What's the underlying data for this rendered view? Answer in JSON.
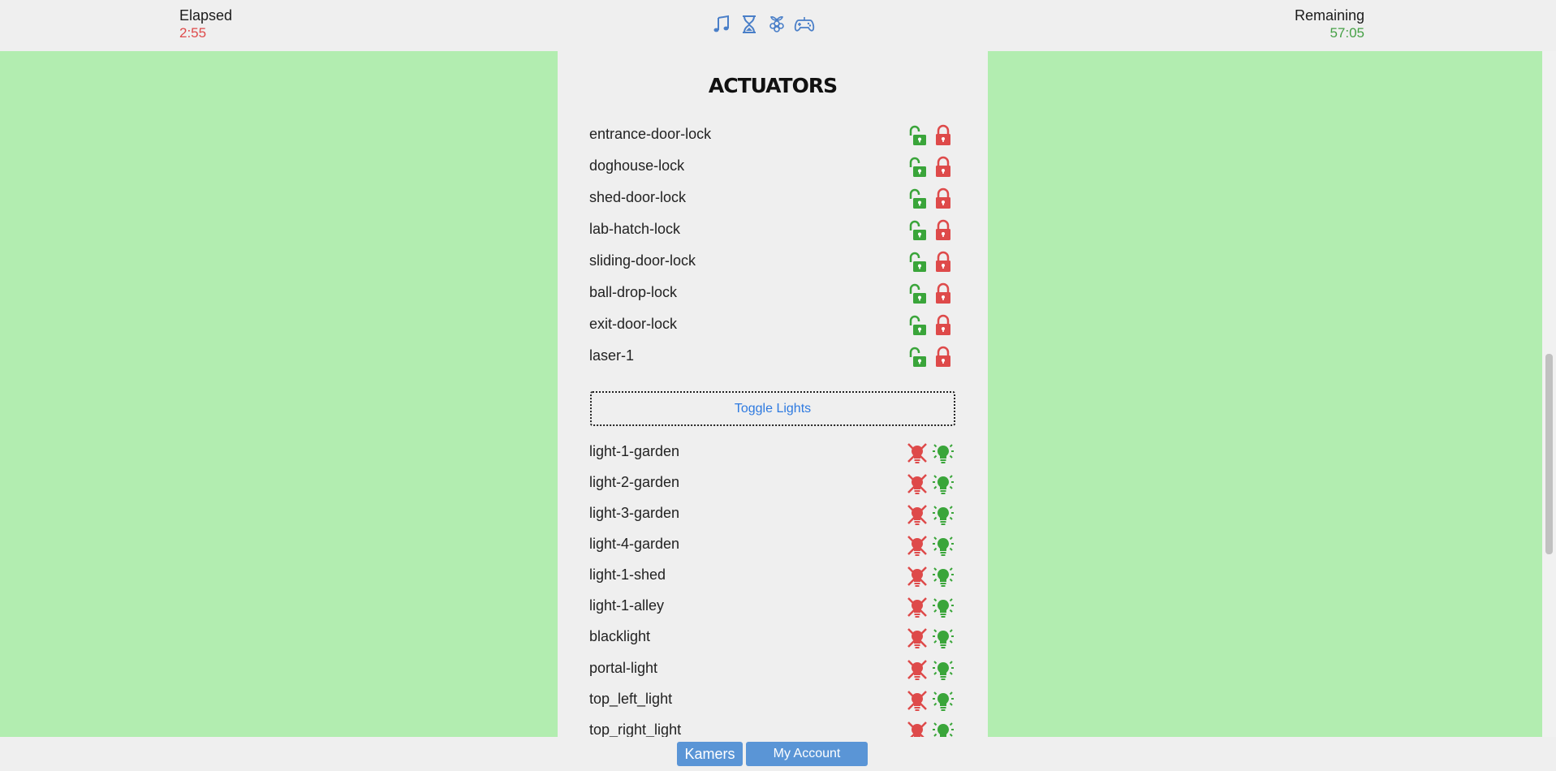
{
  "timer": {
    "elapsed_label": "Elapsed",
    "elapsed_value": "2:55",
    "remaining_label": "Remaining",
    "remaining_value": "57:05"
  },
  "top_icons": [
    "music-icon",
    "hourglass-icon",
    "raspberry-icon",
    "gamepad-icon"
  ],
  "panel": {
    "title": "ACTUATORS",
    "locks": [
      {
        "name": "entrance-door-lock"
      },
      {
        "name": "doghouse-lock"
      },
      {
        "name": "shed-door-lock"
      },
      {
        "name": "lab-hatch-lock"
      },
      {
        "name": "sliding-door-lock"
      },
      {
        "name": "ball-drop-lock"
      },
      {
        "name": "exit-door-lock"
      },
      {
        "name": "laser-1"
      }
    ],
    "toggle_label": "Toggle Lights",
    "lights": [
      {
        "name": "light-1-garden"
      },
      {
        "name": "light-2-garden"
      },
      {
        "name": "light-3-garden"
      },
      {
        "name": "light-4-garden"
      },
      {
        "name": "light-1-shed"
      },
      {
        "name": "light-1-alley"
      },
      {
        "name": "blacklight"
      },
      {
        "name": "portal-light"
      },
      {
        "name": "top_left_light"
      },
      {
        "name": "top_right_light"
      }
    ]
  },
  "bottom": {
    "kamers_label": "Kamers",
    "account_label": "My Account"
  },
  "colors": {
    "background": "#b2edb0",
    "panel": "#efefef",
    "open_green": "#3aa53a",
    "lock_red": "#de4a4a",
    "accent_blue": "#5a95d6"
  }
}
